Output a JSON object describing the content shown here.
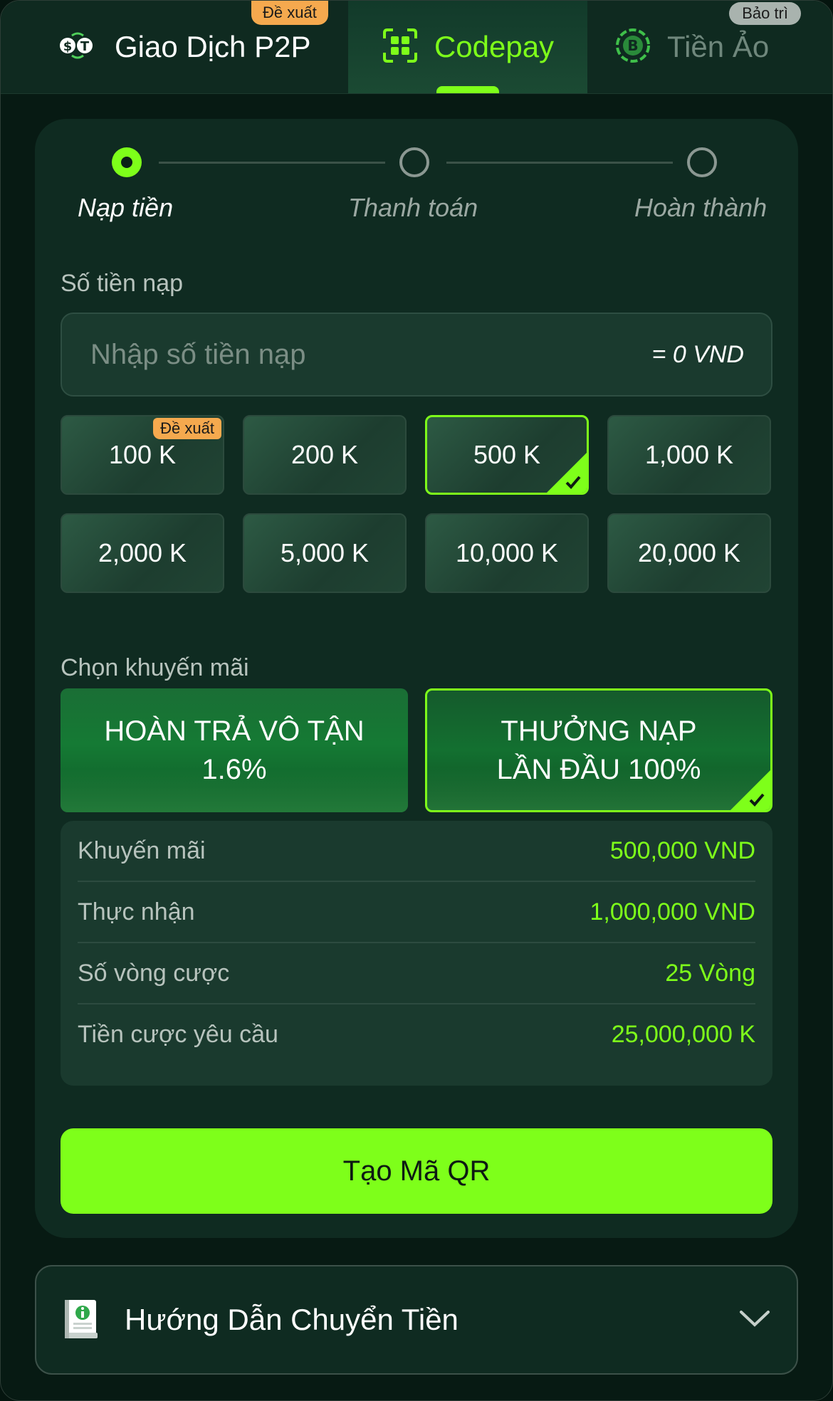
{
  "tabs": [
    {
      "label": "Giao Dịch P2P",
      "tag": "Đề xuất",
      "icon": "p2p-exchange-icon"
    },
    {
      "label": "Codepay",
      "icon": "qr-scan-icon",
      "active": true
    },
    {
      "label": "Tiền Ảo",
      "tag": "Bảo trì",
      "icon": "bitcoin-icon"
    }
  ],
  "steps": [
    {
      "label": "Nạp tiền",
      "active": true
    },
    {
      "label": "Thanh toán",
      "active": false
    },
    {
      "label": "Hoàn thành",
      "active": false
    }
  ],
  "amount": {
    "label": "Số tiền nạp",
    "placeholder": "Nhập số tiền nạp",
    "equivalent": "= 0 VND"
  },
  "quick_amounts": {
    "items": [
      "100 K",
      "200 K",
      "500 K",
      "1,000 K",
      "2,000 K",
      "5,000 K",
      "10,000 K",
      "20,000 K"
    ],
    "recommended_tag": "Đề xuất",
    "selected": "500 K"
  },
  "promotion": {
    "label": "Chọn khuyến mãi",
    "options": [
      {
        "line1": "HOÀN TRẢ VÔ TẬN",
        "line2": "1.6%",
        "selected": false
      },
      {
        "line1": "THƯỞNG NẠP",
        "line2": "LẦN ĐẦU 100%",
        "selected": true
      }
    ]
  },
  "summary": [
    {
      "label": "Khuyến mãi",
      "value": "500,000 VND"
    },
    {
      "label": "Thực nhận",
      "value": "1,000,000 VND"
    },
    {
      "label": "Số vòng cược",
      "value": "25 Vòng"
    },
    {
      "label": "Tiền cược yêu cầu",
      "value": "25,000,000 K"
    }
  ],
  "submit_label": "Tạo Mã QR",
  "guide": {
    "label": "Hướng Dẫn Chuyển Tiền",
    "icon": "guide-book-icon"
  },
  "colors": {
    "accent": "#7eff1a",
    "background": "#071a13",
    "card": "#0f2b21",
    "tag_orange": "#f5a94e"
  }
}
